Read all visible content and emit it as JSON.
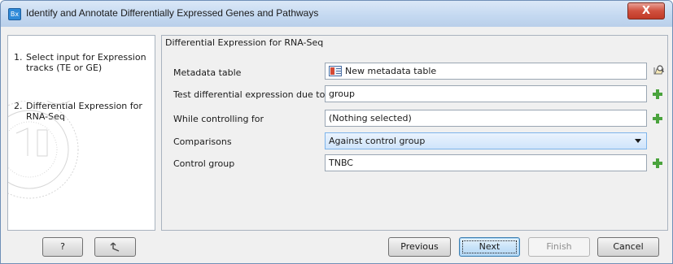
{
  "window": {
    "title": "Identify and Annotate Differentially Expressed Genes and Pathways",
    "app_icon_text": "Bx",
    "close_label": "X"
  },
  "steps": [
    {
      "num": "1.",
      "label": "Select input for Expression tracks (TE or GE)"
    },
    {
      "num": "2.",
      "label": "Differential Expression for RNA-Seq"
    }
  ],
  "section": {
    "title": "Differential Expression for RNA-Seq"
  },
  "fields": {
    "metadata_table": {
      "label": "Metadata table",
      "value": "New metadata table"
    },
    "test_due_to": {
      "label": "Test differential expression due to",
      "value": "group"
    },
    "controlling_for": {
      "label": "While controlling for",
      "value": "(Nothing selected)"
    },
    "comparisons": {
      "label": "Comparisons",
      "value": "Against control group"
    },
    "control_group": {
      "label": "Control group",
      "value": "TNBC"
    }
  },
  "buttons": {
    "help": "?",
    "previous": "Previous",
    "next": "Next",
    "finish": "Finish",
    "cancel": "Cancel"
  },
  "icons": {
    "app": "app-icon",
    "close": "close-icon",
    "metadata": "metadata-table-icon",
    "browse": "browse-icon",
    "add": "plus-icon",
    "reset": "reset-icon",
    "dropdown": "chevron-down-icon"
  },
  "colors": {
    "title_bar": "#c5d9f1",
    "close_button": "#c13a27",
    "add_icon": "#4aa33d",
    "combo_highlight": "#cfe4fb",
    "primary_border": "#3c7fb1"
  }
}
